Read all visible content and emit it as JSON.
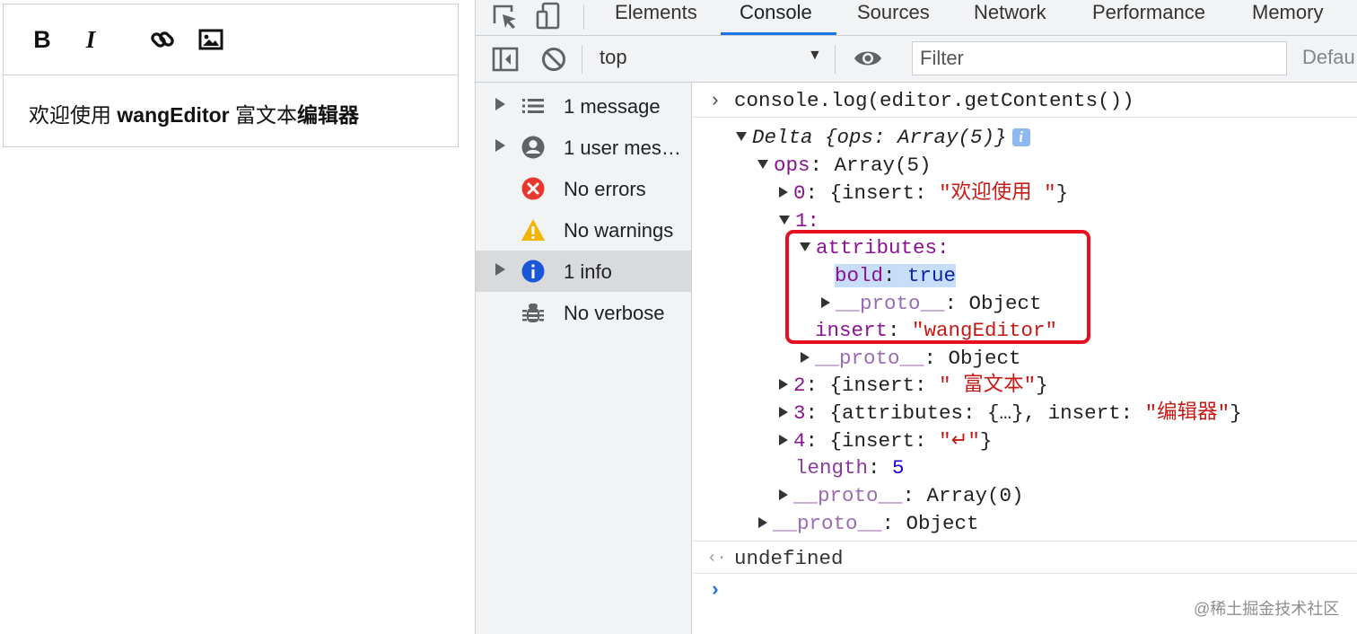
{
  "editor": {
    "toolbar": {
      "bold_label": "B",
      "italic_label": "I",
      "link_icon": "link-icon",
      "image_icon": "image-icon"
    },
    "content": {
      "part1": "欢迎使用 ",
      "part2_bold": "wangEditor",
      "part3": " 富文本",
      "part4_bold": "编辑器"
    }
  },
  "devtools": {
    "tabs": [
      "Elements",
      "Console",
      "Sources",
      "Network",
      "Performance",
      "Memory"
    ],
    "active_tab": "Console",
    "toolbar": {
      "context": "top",
      "filter_placeholder": "Filter",
      "levels_label": "Defau"
    },
    "sidebar": {
      "items": [
        {
          "label": "1 message",
          "icon": "list-icon",
          "expandable": true
        },
        {
          "label": "1 user mes…",
          "icon": "user-icon",
          "expandable": true
        },
        {
          "label": "No errors",
          "icon": "error-icon",
          "expandable": false
        },
        {
          "label": "No warnings",
          "icon": "warning-icon",
          "expandable": false
        },
        {
          "label": "1 info",
          "icon": "info-icon",
          "expandable": true,
          "selected": true
        },
        {
          "label": "No verbose",
          "icon": "bug-icon",
          "expandable": false
        }
      ]
    },
    "console": {
      "command": "console.log(editor.getContents())",
      "delta_header": {
        "name": "Delta",
        "body": "{ops: Array(5)}"
      },
      "ops": {
        "key": "ops",
        "value": "Array(5)"
      },
      "op0": {
        "index": "0",
        "open": "{insert: ",
        "text": "\"欢迎使用 \"",
        "close": "}"
      },
      "op1": {
        "index": "1:"
      },
      "attributes_key": "attributes:",
      "bold_key": "bold",
      "bold_value": "true",
      "proto_key": "__proto__",
      "proto_object": "Object",
      "insert_key": "insert",
      "insert_value": "\"wangEditor\"",
      "op2": {
        "index": "2",
        "open": "{insert: ",
        "text": "\" 富文本\"",
        "close": "}"
      },
      "op3": {
        "index": "3",
        "open": "{attributes: {…}, insert: ",
        "text": "\"编辑器\"",
        "close": "}"
      },
      "op4": {
        "index": "4",
        "open": "{insert: ",
        "text": "\"↵\"",
        "close": "}"
      },
      "length_key": "length",
      "length_value": "5",
      "proto_array": "Array(0)",
      "result": "undefined"
    },
    "watermark": "@稀土掘金技术社区",
    "colors": {
      "accent": "#1a73e8",
      "highlight_border": "#e8101f",
      "string": "#c41a16",
      "key": "#881391"
    }
  }
}
